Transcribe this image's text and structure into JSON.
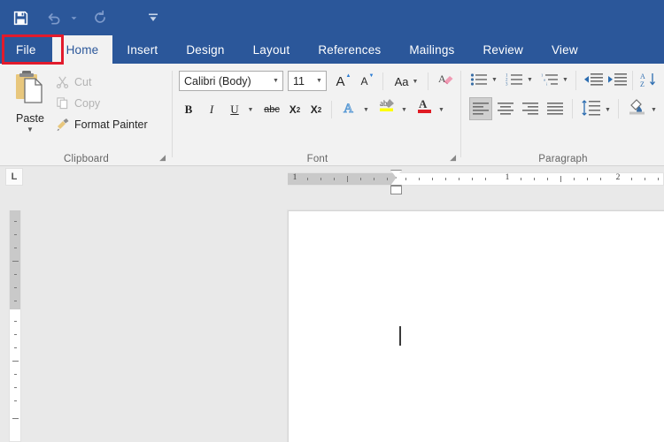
{
  "theme": {
    "ribbon_blue": "#2b579a",
    "ribbon_bg": "#f2f2f2",
    "canvas_gray": "#e9e9e9",
    "annotation_red": "#e21b2c",
    "accent_blue": "#2b579a"
  },
  "quick_access": {
    "items": [
      {
        "name": "save-icon",
        "label": "Save",
        "enabled": true
      },
      {
        "name": "undo-icon",
        "label": "Undo",
        "enabled": false
      },
      {
        "name": "undo-dropdown-icon",
        "label": "Undo options",
        "enabled": false
      },
      {
        "name": "redo-icon",
        "label": "Repeat",
        "enabled": false
      },
      {
        "name": "customize-qat-icon",
        "label": "Customize Quick Access Toolbar",
        "enabled": true
      }
    ]
  },
  "annotation": {
    "target": "File",
    "color": "#e21b2c"
  },
  "tabs": [
    {
      "id": "file",
      "label": "File",
      "active": false,
      "is_file": true
    },
    {
      "id": "home",
      "label": "Home",
      "active": true,
      "is_file": false
    },
    {
      "id": "insert",
      "label": "Insert",
      "active": false,
      "is_file": false
    },
    {
      "id": "design",
      "label": "Design",
      "active": false,
      "is_file": false
    },
    {
      "id": "layout",
      "label": "Layout",
      "active": false,
      "is_file": false
    },
    {
      "id": "references",
      "label": "References",
      "active": false,
      "is_file": false
    },
    {
      "id": "mailings",
      "label": "Mailings",
      "active": false,
      "is_file": false
    },
    {
      "id": "review",
      "label": "Review",
      "active": false,
      "is_file": false
    },
    {
      "id": "view",
      "label": "View",
      "active": false,
      "is_file": false
    }
  ],
  "ribbon": {
    "groups": {
      "clipboard": {
        "label": "Clipboard",
        "launcher": "dialog-launcher",
        "paste": {
          "label": "Paste",
          "caret": "▼",
          "icon": "paste-icon"
        },
        "items": [
          {
            "label": "Cut",
            "icon": "cut-icon",
            "enabled": false
          },
          {
            "label": "Copy",
            "icon": "copy-icon",
            "enabled": false
          },
          {
            "label": "Format Painter",
            "icon": "format-painter-icon",
            "enabled": true
          }
        ]
      },
      "font": {
        "label": "Font",
        "launcher": "dialog-launcher",
        "font_name": {
          "value": "Calibri (Body)",
          "placeholder": "Font"
        },
        "font_size": {
          "value": "11",
          "placeholder": "Size"
        },
        "row1": [
          {
            "label": "A",
            "icon": "grow-font-icon",
            "sup": "▲"
          },
          {
            "label": "A",
            "icon": "shrink-font-icon",
            "sup": "▼"
          },
          {
            "label": "Aa",
            "icon": "change-case-icon",
            "caret": "▼"
          },
          {
            "label": "A",
            "icon": "clear-formatting-icon",
            "sup": ""
          }
        ],
        "row2": [
          {
            "label": "B",
            "icon": "bold-icon"
          },
          {
            "label": "I",
            "icon": "italic-icon"
          },
          {
            "label": "U",
            "icon": "underline-icon",
            "caret": "▼"
          },
          {
            "label": "abc",
            "icon": "strikethrough-icon"
          },
          {
            "label": "X",
            "icon": "subscript-icon",
            "sub": "2"
          },
          {
            "label": "X",
            "icon": "superscript-icon",
            "sup": "2"
          },
          {
            "label": "A",
            "icon": "text-effects-icon",
            "caret": "▼"
          },
          {
            "label": "ab",
            "icon": "text-highlight-icon",
            "caret": "▼"
          },
          {
            "label": "A",
            "icon": "font-color-icon",
            "caret": "▼"
          }
        ]
      },
      "paragraph": {
        "label": "Paragraph",
        "row1": [
          {
            "icon": "bullets-icon",
            "caret": "▼"
          },
          {
            "icon": "numbering-icon",
            "caret": "▼"
          },
          {
            "icon": "multilevel-list-icon",
            "caret": "▼"
          },
          {
            "icon": "decrease-indent-icon",
            "caret": ""
          },
          {
            "icon": "increase-indent-icon",
            "caret": ""
          },
          {
            "icon": "sort-icon",
            "caret": ""
          }
        ],
        "row2": [
          {
            "icon": "align-left-icon",
            "selected": true
          },
          {
            "icon": "align-center-icon",
            "selected": false
          },
          {
            "icon": "align-right-icon",
            "selected": false
          },
          {
            "icon": "justify-icon",
            "selected": false
          },
          {
            "icon": "line-spacing-icon",
            "selected": false,
            "caret": "▼"
          },
          {
            "icon": "shading-icon",
            "selected": false,
            "caret": "▼"
          }
        ]
      }
    }
  },
  "ruler": {
    "tab_selector": {
      "icon": "left-tab-stop-icon",
      "label": "L"
    },
    "horizontal_numbers": [
      "1",
      "1",
      "2"
    ],
    "indent_marker": "first-line-indent-marker",
    "units": "inches"
  },
  "document": {
    "page_label": "blank-page",
    "caret_visible": true,
    "content": ""
  }
}
